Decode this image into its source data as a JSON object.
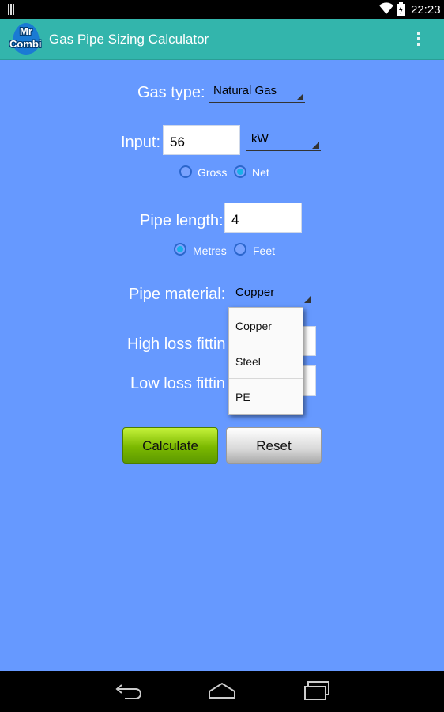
{
  "status_bar": {
    "time": "22:23"
  },
  "app": {
    "logo_line1": "Mr",
    "logo_line2": "Combi",
    "title": "Gas Pipe Sizing Calculator"
  },
  "form": {
    "gas_type_label": "Gas type:",
    "gas_type_value": "Natural Gas",
    "input_label": "Input:",
    "input_value": "56",
    "input_unit": "kW",
    "gross_label": "Gross",
    "net_label": "Net",
    "input_basis_selected": "Net",
    "pipe_length_label": "Pipe length:",
    "pipe_length_value": "4",
    "metres_label": "Metres",
    "feet_label": "Feet",
    "length_unit_selected": "Metres",
    "pipe_material_label": "Pipe material:",
    "pipe_material_value": "Copper",
    "high_loss_label": "High loss fittin",
    "low_loss_label": "Low loss fittin"
  },
  "dropdown": {
    "options": [
      "Copper",
      "Steel",
      "PE"
    ]
  },
  "buttons": {
    "calculate": "Calculate",
    "reset": "Reset"
  },
  "colors": {
    "background": "#6699ff",
    "action_bar": "#33b5ac",
    "accent": "#1ab0e8"
  },
  "icons": {
    "wifi": "wifi-icon",
    "battery": "battery-icon",
    "overflow": "overflow-menu-icon",
    "back": "back-icon",
    "home": "home-icon",
    "recents": "recents-icon"
  }
}
